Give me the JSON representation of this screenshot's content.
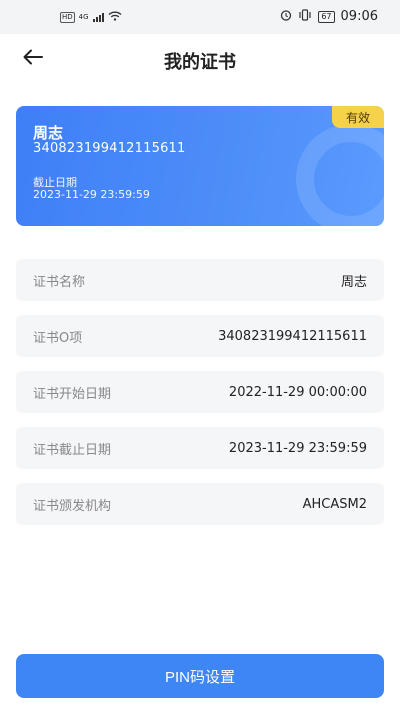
{
  "status_bar": {
    "network_type": "4G",
    "hd_badge": "HD",
    "battery": "67",
    "time": "09:06",
    "icons": [
      "wifi-icon",
      "alarm-icon",
      "vibrate-icon",
      "battery-icon"
    ]
  },
  "header": {
    "title": "我的证书"
  },
  "card": {
    "badge": "有效",
    "name": "周志",
    "id_number": "340823199412115611",
    "expiry_label": "截止日期",
    "expiry_date": "2023-11-29 23:59:59"
  },
  "rows": [
    {
      "label": "证书名称",
      "value": "周志"
    },
    {
      "label": "证书O项",
      "value": "340823199412115611"
    },
    {
      "label": "证书开始日期",
      "value": "2022-11-29 00:00:00"
    },
    {
      "label": "证书截止日期",
      "value": "2023-11-29 23:59:59"
    },
    {
      "label": "证书颁发机构",
      "value": "AHCASM2"
    }
  ],
  "pin_button": {
    "label": "PIN码设置"
  },
  "colors": {
    "accent": "#3f86f5",
    "badge": "#f6d14a"
  }
}
